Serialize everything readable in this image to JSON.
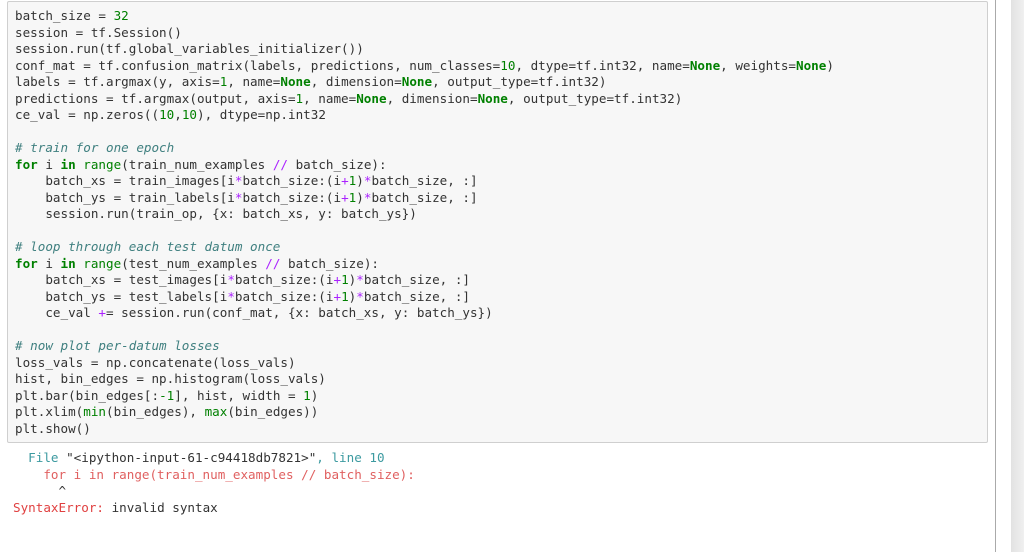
{
  "cell": {
    "lines": [
      "batch_size = 32",
      "session = tf.Session()",
      "session.run(tf.global_variables_initializer())",
      "conf_mat = tf.confusion_matrix(labels, predictions, num_classes=10, dtype=tf.int32, name=None, weights=None)",
      "labels = tf.argmax(y, axis=1, name=None, dimension=None, output_type=tf.int32)",
      "predictions = tf.argmax(output, axis=1, name=None, dimension=None, output_type=tf.int32)",
      "ce_val = np.zeros((10,10), dtype=np.int32",
      "",
      "# train for one epoch",
      "for i in range(train_num_examples // batch_size):",
      "    batch_xs = train_images[i*batch_size:(i+1)*batch_size, :]",
      "    batch_ys = train_labels[i*batch_size:(i+1)*batch_size, :]",
      "    session.run(train_op, {x: batch_xs, y: batch_ys})",
      "",
      "# loop through each test datum once",
      "for i in range(test_num_examples // batch_size):",
      "    batch_xs = test_images[i*batch_size:(i+1)*batch_size, :]",
      "    batch_ys = test_labels[i*batch_size:(i+1)*batch_size, :]",
      "    ce_val += session.run(conf_mat, {x: batch_xs, y: batch_ys})",
      "",
      "# now plot per-datum losses",
      "loss_vals = np.concatenate(loss_vals)",
      "hist, bin_edges = np.histogram(loss_vals)",
      "plt.bar(bin_edges[:-1], hist, width = 1)",
      "plt.xlim(min(bin_edges), max(bin_edges))",
      "plt.show()"
    ]
  },
  "output": {
    "file_prefix": "  File ",
    "file_name": "\"<ipython-input-61-c94418db7821>\"",
    "line_label": ", line ",
    "line_number": "10",
    "source_line": "    for i in range(train_num_examples // batch_size):",
    "caret": "      ^",
    "error_type": "SyntaxError",
    "error_sep": ": ",
    "error_message": "invalid syntax"
  },
  "colors": {
    "keyword": "#008000",
    "comment": "#408080",
    "operator": "#aa22ff",
    "traceback_file": "#3c9aa0",
    "traceback_source": "#e06060",
    "error": "#e04040",
    "cell_background": "#f7f7f7",
    "cell_border": "#cfcfcf"
  }
}
